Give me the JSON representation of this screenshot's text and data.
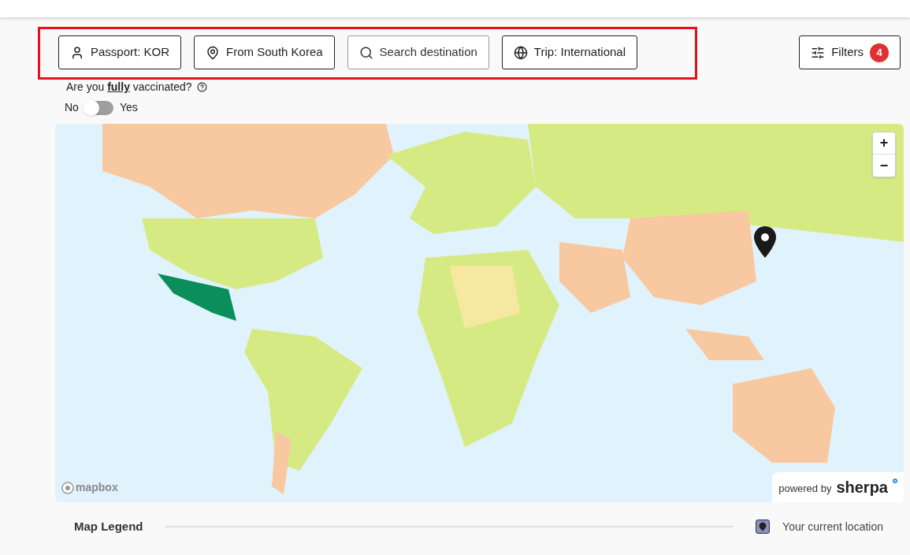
{
  "filter_chips": [
    {
      "kind": "passport",
      "label": "Passport: KOR"
    },
    {
      "kind": "origin",
      "label": "From South Korea"
    },
    {
      "kind": "search",
      "label": "Search destination"
    },
    {
      "kind": "trip",
      "label": "Trip: International"
    }
  ],
  "filters_button": {
    "label": "Filters",
    "count": "4"
  },
  "vaccination": {
    "question": "Are you **fully** vaccinated?",
    "off_label": "No",
    "on_label": "Yes",
    "on": false
  },
  "map": {
    "zoom_in": "+",
    "zoom_out": "−",
    "attribution": "mapbox",
    "powered_by": "powered by",
    "brand": "sherpa"
  },
  "legend": {
    "title": "Map Legend",
    "items": [
      {
        "label": "Your current location"
      }
    ]
  }
}
